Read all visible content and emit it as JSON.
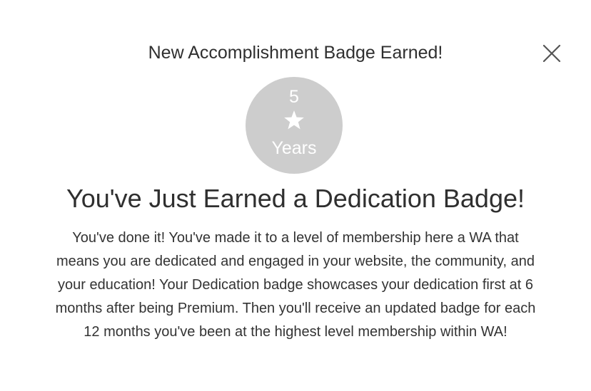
{
  "modal": {
    "header": "New Accomplishment Badge Earned!",
    "close_icon": "close-icon"
  },
  "badge": {
    "count": "5",
    "icon": "star-icon",
    "unit": "Years",
    "background_color": "#cdcdcd"
  },
  "content": {
    "title": "You've Just Earned a Dedication Badge!",
    "body": "You've done it! You've made it to a level of membership here a WA that means you are dedicated and engaged in your website, the community, and your education! Your Dedication badge showcases your dedication first at 6 months after being Premium. Then you'll receive an updated badge for each 12 months you've been at the highest level membership within WA!"
  }
}
